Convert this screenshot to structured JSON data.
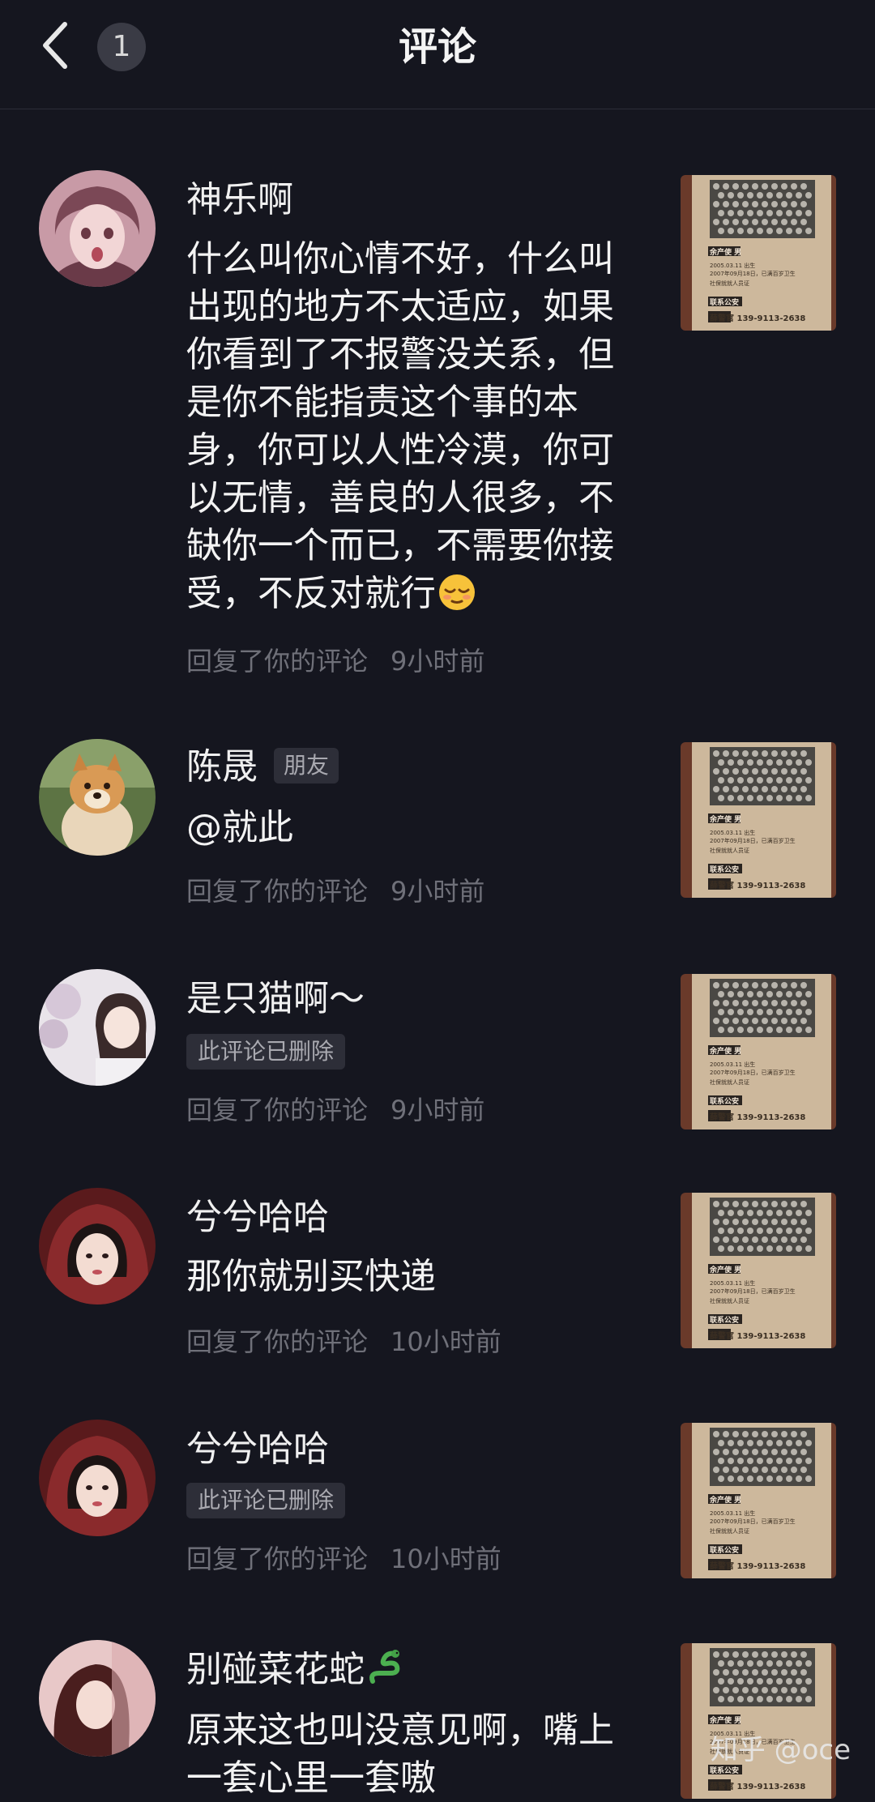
{
  "header": {
    "title": "评论",
    "badge_count": "1",
    "back_icon": "chevron-left-icon"
  },
  "comments": [
    {
      "name": "神乐啊",
      "text": "什么叫你心情不好，什么叫出现的地方不太适应，如果你看到了不报警没关系，但是你不能指责这个事的本身，你可以人性冷漠，你可以无情，善良的人很多，不缺你一个而已，不需要你接受，不反对就行",
      "meta": "回复了你的评论",
      "time": "9小时前"
    },
    {
      "name": "陈晟",
      "tag": "朋友",
      "text": "@就此",
      "meta": "回复了你的评论",
      "time": "9小时前"
    },
    {
      "name": "是只猫啊～",
      "deleted": "此评论已删除",
      "meta": "回复了你的评论",
      "time": "9小时前"
    },
    {
      "name": "兮兮哈哈",
      "text": "那你就别买快递",
      "meta": "回复了你的评论",
      "time": "10小时前"
    },
    {
      "name": "兮兮哈哈",
      "deleted": "此评论已删除",
      "meta": "回复了你的评论",
      "time": "10小时前"
    },
    {
      "name": "别碰菜花蛇",
      "text": "原来这也叫没意见啊，嘴上一套心里一套嗷"
    }
  ],
  "thumbnail": {
    "label_top": "余产使 男",
    "line1": "2005.03.11 出生",
    "line2": "2007年09月18日，已满百岁卫生",
    "line3": "社保就就人员证",
    "contact": "联系公安",
    "phone": "薛警官 139-9113-2638"
  },
  "watermark": "知乎 @oce",
  "colors": {
    "background": "#15161f",
    "meta_text": "#6f7079",
    "tag_bg": "#2d2e38"
  }
}
